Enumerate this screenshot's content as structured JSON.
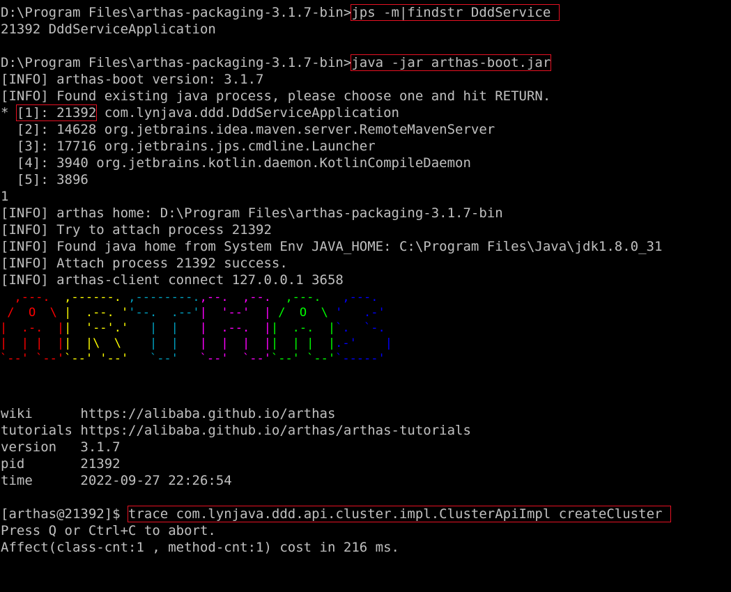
{
  "terminal": {
    "lines": [
      {
        "pre": "D:\\Program Files\\arthas-packaging-3.1.7-bin>",
        "cmd": "jps -m|findstr DddService"
      },
      {
        "text": "21392 DddServiceApplication"
      },
      {
        "pre": "D:\\Program Files\\arthas-packaging-3.1.7-bin>",
        "cmd": "java -jar arthas-boot.jar"
      },
      {
        "text": "[INFO] arthas-boot version: 3.1.7"
      },
      {
        "text": "[INFO] Found existing java process, please choose one and hit RETURN."
      },
      {
        "pre": "* ",
        "sel": "[1]: 21392",
        "post": " com.lynjava.ddd.DddServiceApplication"
      },
      {
        "text": "  [2]: 14628 org.jetbrains.idea.maven.server.RemoteMavenServer"
      },
      {
        "text": "  [3]: 17716 org.jetbrains.jps.cmdline.Launcher"
      },
      {
        "text": "  [4]: 3940 org.jetbrains.kotlin.daemon.KotlinCompileDaemon"
      },
      {
        "text": "  [5]: 3896"
      },
      {
        "text": "1"
      },
      {
        "text": "[INFO] arthas home: D:\\Program Files\\arthas-packaging-3.1.7-bin"
      },
      {
        "text": "[INFO] Try to attach process 21392"
      },
      {
        "text": "[INFO] Found java home from System Env JAVA_HOME: C:\\Program Files\\Java\\jdk1.8.0_31"
      },
      {
        "text": "[INFO] Attach process 21392 success."
      },
      {
        "text": "[INFO] arthas-client connect 127.0.0.1 3658"
      }
    ],
    "logo": {
      "letters": [
        {
          "color": "#ff0000",
          "rows": [
            "  ,---.  ",
            " /  O  \\ ",
            "|  .-.  |",
            "|  | |  |",
            "`--' `--'"
          ]
        },
        {
          "color": "#ffff00",
          "rows": [
            ",------. ",
            "|  .--. '",
            "|  '--'.'",
            "|  |\\  \\ ",
            "`--' '--'"
          ]
        },
        {
          "color": "#00a0c0",
          "rows": [
            ",--------.",
            "'--.  .--'",
            "   |  |   ",
            "   |  |   ",
            "   `--'   "
          ]
        },
        {
          "color": "#ff00ff",
          "rows": [
            ",--.  ,--.",
            "|  '--'  |",
            "|  .--.  |",
            "|  |  |  |",
            "`--'  `--'"
          ]
        },
        {
          "color": "#00ff00",
          "rows": [
            "  ,---.  ",
            " /  O  \\ ",
            "|  .-.  |",
            "|  | |  |",
            "`--' `--'"
          ]
        },
        {
          "color": "#0000ff",
          "rows": [
            " ,---.  ",
            "'   .-' ",
            "`.  `-. ",
            ".-'    |",
            "`-----' "
          ]
        }
      ]
    },
    "info": [
      {
        "key": "wiki     ",
        "value": " https://alibaba.github.io/arthas"
      },
      {
        "key": "tutorials",
        "value": " https://alibaba.github.io/arthas/arthas-tutorials"
      },
      {
        "key": "version  ",
        "value": " 3.1.7"
      },
      {
        "key": "pid      ",
        "value": " 21392"
      },
      {
        "key": "time     ",
        "value": " 2022-09-27 22:26:54"
      }
    ],
    "prompt": "[arthas@21392]$ ",
    "trace_cmd": "trace com.lynjava.ddd.api.cluster.impl.ClusterApiImpl createCluster ",
    "abort_hint": "Press Q or Ctrl+C to abort.",
    "affect": "Affect(class-cnt:1 , method-cnt:1) cost in 216 ms."
  }
}
